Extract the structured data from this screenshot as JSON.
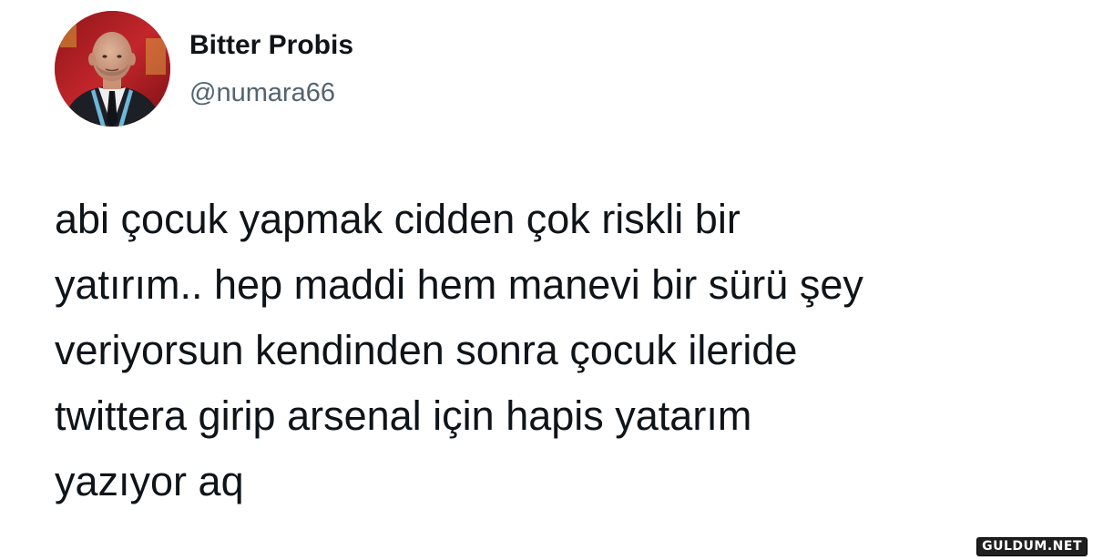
{
  "tweet": {
    "author": {
      "display_name": "Bitter Probis",
      "handle": "@numara66",
      "avatar_icon": "profile-photo-icon"
    },
    "text_lines": [
      "abi çocuk yapmak cidden çok riskli bir",
      "yatırım.. hep maddi hem manevi bir sürü şey",
      "veriyorsun kendinden sonra çocuk ileride",
      "twittera girip arsenal için hapis yatarım",
      "yazıyor aq"
    ]
  },
  "watermark": {
    "text": "GULDUM.NET"
  },
  "colors": {
    "background": "#ffffff",
    "text_primary": "#0f1419",
    "text_secondary": "#536471",
    "avatar_background": "#b01e24"
  }
}
